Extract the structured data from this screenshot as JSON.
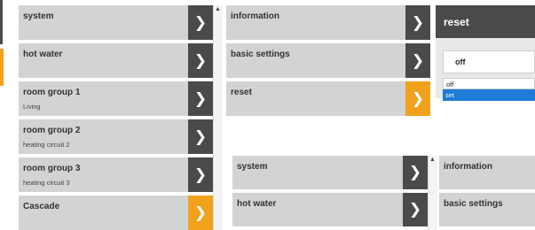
{
  "left_edge": {
    "accent": "#f0a21c",
    "dark": "#4a4a4a"
  },
  "menu_a": {
    "items": [
      {
        "label": "system",
        "sub": ""
      },
      {
        "label": "hot water",
        "sub": ""
      },
      {
        "label": "room group 1",
        "sub": "Living"
      },
      {
        "label": "room group 2",
        "sub": "heating circuit 2"
      },
      {
        "label": "room group 3",
        "sub": "heating circuit 3"
      },
      {
        "label": "Cascade",
        "sub": ""
      }
    ]
  },
  "menu_b": {
    "items": [
      {
        "label": "information"
      },
      {
        "label": "basic settings"
      },
      {
        "label": "reset"
      }
    ]
  },
  "reset_panel": {
    "title": "reset",
    "selected_value": "off",
    "options": [
      "off",
      "set"
    ],
    "highlighted_option": "set"
  },
  "menu_c": {
    "items": [
      {
        "label": "system"
      },
      {
        "label": "hot water"
      }
    ]
  },
  "menu_d": {
    "items": [
      {
        "label": "information"
      },
      {
        "label": "basic settings"
      }
    ]
  },
  "icons": {
    "arrow": "❯",
    "scroll_up": "▲"
  },
  "colors": {
    "tile": "#d3d3d3",
    "arrow_dark": "#4a4a4a",
    "arrow_active": "#f0a21c",
    "highlight": "#1e7bd6"
  }
}
